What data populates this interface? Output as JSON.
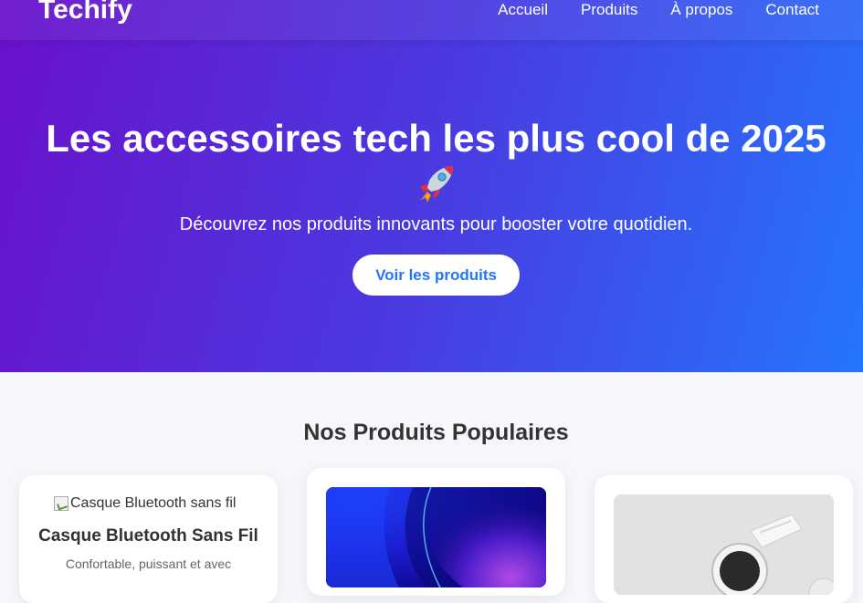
{
  "brand": {
    "logo": "Techify"
  },
  "nav": {
    "links": [
      "Accueil",
      "Produits",
      "À propos",
      "Contact"
    ]
  },
  "hero": {
    "title": "Les accessoires tech les plus cool de 2025",
    "emoji_icon": "rocket-icon",
    "subtitle": "Découvrez nos produits innovants pour booster votre quotidien.",
    "cta_label": "Voir les produits"
  },
  "products_section": {
    "title": "Nos Produits Populaires",
    "products": [
      {
        "image_alt": "Casque Bluetooth sans fil",
        "name": "Casque Bluetooth Sans Fil",
        "description": "Confortable, puissant et avec"
      },
      {
        "image": "blue-abstract-wallpaper-image"
      },
      {
        "image": "white-smartwatch-image"
      }
    ]
  },
  "colors": {
    "gradient_start": "#6a11cb",
    "gradient_end": "#2575fc",
    "cta_text": "#2575fc",
    "page_background": "#f5f7fa"
  }
}
